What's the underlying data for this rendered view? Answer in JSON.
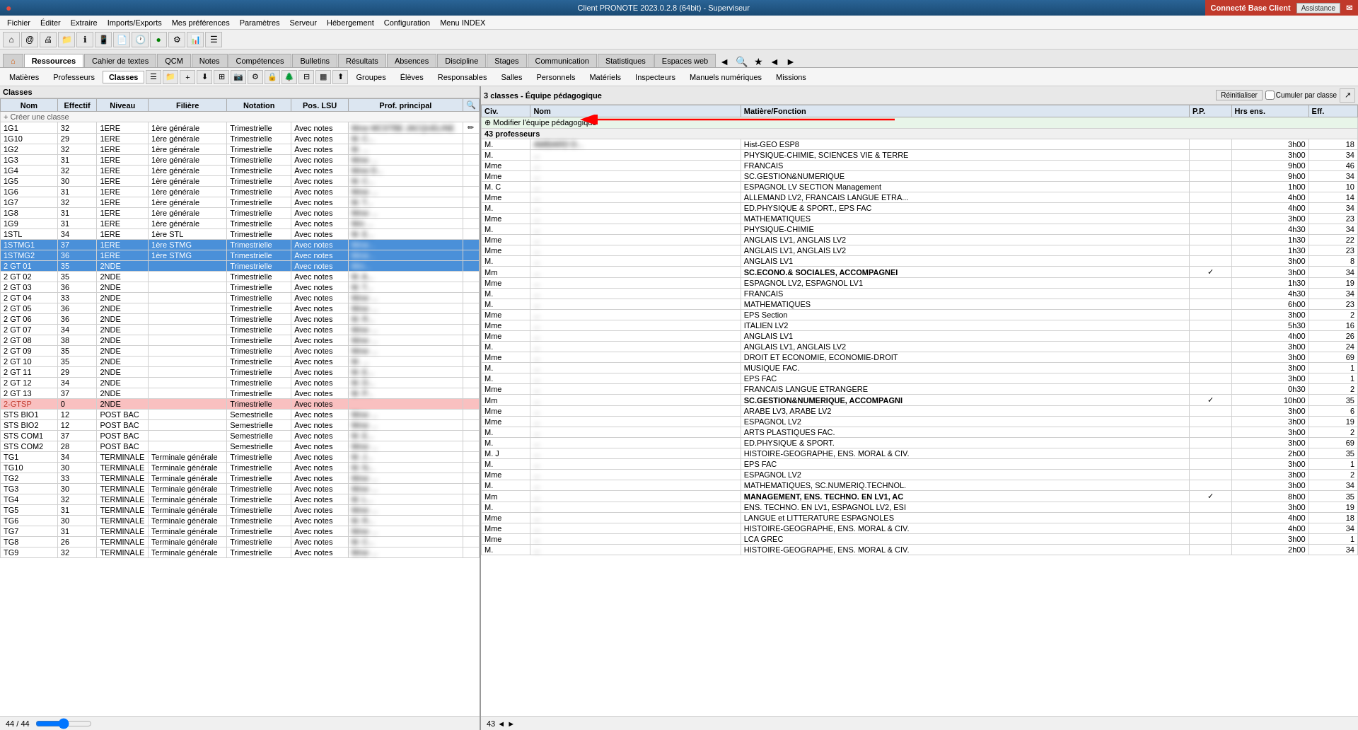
{
  "titleBar": {
    "title": "Client PRONOTE 2023.0.2.8 (64bit) - Superviseur",
    "connected": "Connecté Base Client",
    "assistance": "Assistance"
  },
  "menuBar": {
    "items": [
      "Fichier",
      "Éditer",
      "Extraire",
      "Imports/Exports",
      "Mes préférences",
      "Paramètres",
      "Serveur",
      "Hébergement",
      "Configuration",
      "Menu INDEX"
    ]
  },
  "navTabs": {
    "tabs": [
      "Ressources",
      "Cahier de textes",
      "QCM",
      "Notes",
      "Compétences",
      "Bulletins",
      "Résultats",
      "Absences",
      "Discipline",
      "Stages",
      "Communication",
      "Statistiques",
      "Espaces web"
    ]
  },
  "subNav": {
    "items": [
      "Matières",
      "Professeurs",
      "Classes",
      "Groupes",
      "Élèves",
      "Responsables",
      "Salles",
      "Personnels",
      "Matériels",
      "Inspecteurs",
      "Manuels numériques",
      "Missions"
    ]
  },
  "leftPanel": {
    "header": "Classes",
    "columns": [
      "Nom",
      "Effectif",
      "Niveau",
      "Filière",
      "Notation",
      "Pos. LSU",
      "Prof. principal"
    ],
    "createRow": "+ Créer une classe",
    "rows": [
      {
        "nom": "1G1",
        "effectif": "32",
        "niveau": "1ERE",
        "filiere": "1ère générale",
        "notation": "Trimestrielle",
        "posLSU": "Avec notes",
        "prof": "Mme MCSTBE JACQUELINE"
      },
      {
        "nom": "1G10",
        "effectif": "29",
        "niveau": "1ERE",
        "filiere": "1ère générale",
        "notation": "Trimestrielle",
        "posLSU": "Avec notes",
        "prof": "M. C..."
      },
      {
        "nom": "1G2",
        "effectif": "32",
        "niveau": "1ERE",
        "filiere": "1ère générale",
        "notation": "Trimestrielle",
        "posLSU": "Avec notes",
        "prof": "M. ..."
      },
      {
        "nom": "1G3",
        "effectif": "31",
        "niveau": "1ERE",
        "filiere": "1ère générale",
        "notation": "Trimestrielle",
        "posLSU": "Avec notes",
        "prof": "Mme ..."
      },
      {
        "nom": "1G4",
        "effectif": "32",
        "niveau": "1ERE",
        "filiere": "1ère générale",
        "notation": "Trimestrielle",
        "posLSU": "Avec notes",
        "prof": "Mme D..."
      },
      {
        "nom": "1G5",
        "effectif": "30",
        "niveau": "1ERE",
        "filiere": "1ère générale",
        "notation": "Trimestrielle",
        "posLSU": "Avec notes",
        "prof": "M. C..."
      },
      {
        "nom": "1G6",
        "effectif": "31",
        "niveau": "1ERE",
        "filiere": "1ère générale",
        "notation": "Trimestrielle",
        "posLSU": "Avec notes",
        "prof": "Mme ..."
      },
      {
        "nom": "1G7",
        "effectif": "32",
        "niveau": "1ERE",
        "filiere": "1ère générale",
        "notation": "Trimestrielle",
        "posLSU": "Avec notes",
        "prof": "M. T..."
      },
      {
        "nom": "1G8",
        "effectif": "31",
        "niveau": "1ERE",
        "filiere": "1ère générale",
        "notation": "Trimestrielle",
        "posLSU": "Avec notes",
        "prof": "Mme ..."
      },
      {
        "nom": "1G9",
        "effectif": "31",
        "niveau": "1ERE",
        "filiere": "1ère générale",
        "notation": "Trimestrielle",
        "posLSU": "Avec notes",
        "prof": "Mm ..."
      },
      {
        "nom": "1STL",
        "effectif": "34",
        "niveau": "1ERE",
        "filiere": "1ère STL",
        "notation": "Trimestrielle",
        "posLSU": "Avec notes",
        "prof": "M. E..."
      },
      {
        "nom": "1STMG1",
        "effectif": "37",
        "niveau": "1ERE",
        "filiere": "1ère STMG",
        "notation": "Trimestrielle",
        "posLSU": "Avec notes",
        "prof": "Mme...",
        "selected": true
      },
      {
        "nom": "1STMG2",
        "effectif": "36",
        "niveau": "1ERE",
        "filiere": "1ère STMG",
        "notation": "Trimestrielle",
        "posLSU": "Avec notes",
        "prof": "Mme...",
        "selected": true
      },
      {
        "nom": "2 GT 01",
        "effectif": "35",
        "niveau": "2NDE",
        "filiere": "",
        "notation": "Trimestrielle",
        "posLSU": "Avec notes",
        "prof": "Mm...",
        "selected": true
      },
      {
        "nom": "2 GT 02",
        "effectif": "35",
        "niveau": "2NDE",
        "filiere": "",
        "notation": "Trimestrielle",
        "posLSU": "Avec notes",
        "prof": "M. A..."
      },
      {
        "nom": "2 GT 03",
        "effectif": "36",
        "niveau": "2NDE",
        "filiere": "",
        "notation": "Trimestrielle",
        "posLSU": "Avec notes",
        "prof": "M. T..."
      },
      {
        "nom": "2 GT 04",
        "effectif": "33",
        "niveau": "2NDE",
        "filiere": "",
        "notation": "Trimestrielle",
        "posLSU": "Avec notes",
        "prof": "Mme ..."
      },
      {
        "nom": "2 GT 05",
        "effectif": "36",
        "niveau": "2NDE",
        "filiere": "",
        "notation": "Trimestrielle",
        "posLSU": "Avec notes",
        "prof": "Mme ..."
      },
      {
        "nom": "2 GT 06",
        "effectif": "36",
        "niveau": "2NDE",
        "filiere": "",
        "notation": "Trimestrielle",
        "posLSU": "Avec notes",
        "prof": "M. R..."
      },
      {
        "nom": "2 GT 07",
        "effectif": "34",
        "niveau": "2NDE",
        "filiere": "",
        "notation": "Trimestrielle",
        "posLSU": "Avec notes",
        "prof": "Mme ..."
      },
      {
        "nom": "2 GT 08",
        "effectif": "38",
        "niveau": "2NDE",
        "filiere": "",
        "notation": "Trimestrielle",
        "posLSU": "Avec notes",
        "prof": "Mme ..."
      },
      {
        "nom": "2 GT 09",
        "effectif": "35",
        "niveau": "2NDE",
        "filiere": "",
        "notation": "Trimestrielle",
        "posLSU": "Avec notes",
        "prof": "Mme ..."
      },
      {
        "nom": "2 GT 10",
        "effectif": "35",
        "niveau": "2NDE",
        "filiere": "",
        "notation": "Trimestrielle",
        "posLSU": "Avec notes",
        "prof": "M. ..."
      },
      {
        "nom": "2 GT 11",
        "effectif": "29",
        "niveau": "2NDE",
        "filiere": "",
        "notation": "Trimestrielle",
        "posLSU": "Avec notes",
        "prof": "M. E..."
      },
      {
        "nom": "2 GT 12",
        "effectif": "34",
        "niveau": "2NDE",
        "filiere": "",
        "notation": "Trimestrielle",
        "posLSU": "Avec notes",
        "prof": "M. D..."
      },
      {
        "nom": "2 GT 13",
        "effectif": "37",
        "niveau": "2NDE",
        "filiere": "",
        "notation": "Trimestrielle",
        "posLSU": "Avec notes",
        "prof": "M. P..."
      },
      {
        "nom": "2-GTSP",
        "effectif": "0",
        "niveau": "2NDE",
        "filiere": "",
        "notation": "Trimestrielle",
        "posLSU": "Avec notes",
        "prof": "",
        "highlighted": true
      },
      {
        "nom": "STS BIO1",
        "effectif": "12",
        "niveau": "POST BAC",
        "filiere": "",
        "notation": "Semestrielle",
        "posLSU": "Avec notes",
        "prof": "Mme ..."
      },
      {
        "nom": "STS BIO2",
        "effectif": "12",
        "niveau": "POST BAC",
        "filiere": "",
        "notation": "Semestrielle",
        "posLSU": "Avec notes",
        "prof": "Mme ..."
      },
      {
        "nom": "STS COM1",
        "effectif": "37",
        "niveau": "POST BAC",
        "filiere": "",
        "notation": "Semestrielle",
        "posLSU": "Avec notes",
        "prof": "M. E..."
      },
      {
        "nom": "STS COM2",
        "effectif": "28",
        "niveau": "POST BAC",
        "filiere": "",
        "notation": "Semestrielle",
        "posLSU": "Avec notes",
        "prof": "Mme ..."
      },
      {
        "nom": "TG1",
        "effectif": "34",
        "niveau": "TERMINALE",
        "filiere": "Terminale générale",
        "notation": "Trimestrielle",
        "posLSU": "Avec notes",
        "prof": "M. J..."
      },
      {
        "nom": "TG10",
        "effectif": "30",
        "niveau": "TERMINALE",
        "filiere": "Terminale générale",
        "notation": "Trimestrielle",
        "posLSU": "Avec notes",
        "prof": "M. N..."
      },
      {
        "nom": "TG2",
        "effectif": "33",
        "niveau": "TERMINALE",
        "filiere": "Terminale générale",
        "notation": "Trimestrielle",
        "posLSU": "Avec notes",
        "prof": "Mme ..."
      },
      {
        "nom": "TG3",
        "effectif": "30",
        "niveau": "TERMINALE",
        "filiere": "Terminale générale",
        "notation": "Trimestrielle",
        "posLSU": "Avec notes",
        "prof": "Mme ..."
      },
      {
        "nom": "TG4",
        "effectif": "32",
        "niveau": "TERMINALE",
        "filiere": "Terminale générale",
        "notation": "Trimestrielle",
        "posLSU": "Avec notes",
        "prof": "M. L..."
      },
      {
        "nom": "TG5",
        "effectif": "31",
        "niveau": "TERMINALE",
        "filiere": "Terminale générale",
        "notation": "Trimestrielle",
        "posLSU": "Avec notes",
        "prof": "Mme ..."
      },
      {
        "nom": "TG6",
        "effectif": "30",
        "niveau": "TERMINALE",
        "filiere": "Terminale générale",
        "notation": "Trimestrielle",
        "posLSU": "Avec notes",
        "prof": "M. R..."
      },
      {
        "nom": "TG7",
        "effectif": "31",
        "niveau": "TERMINALE",
        "filiere": "Terminale générale",
        "notation": "Trimestrielle",
        "posLSU": "Avec notes",
        "prof": "Mme ..."
      },
      {
        "nom": "TG8",
        "effectif": "26",
        "niveau": "TERMINALE",
        "filiere": "Terminale générale",
        "notation": "Trimestrielle",
        "posLSU": "Avec notes",
        "prof": "M. C..."
      },
      {
        "nom": "TG9",
        "effectif": "32",
        "niveau": "TERMINALE",
        "filiere": "Terminale générale",
        "notation": "Trimestrielle",
        "posLSU": "Avec notes",
        "prof": "Mme ..."
      }
    ]
  },
  "rightPanel": {
    "header": "3 classes - Équipe pédagogique",
    "resetBtn": "Réinitialiser",
    "cumulerLabel": "Cumuler par classe",
    "columns": [
      "Civ.",
      "Nom",
      "Matière/Fonction",
      "P.P.",
      "Hrs ens.",
      "Eff."
    ],
    "modifyRow": "Modifier l'équipe pédagogique",
    "teacherCount": "43 professeurs",
    "teachers": [
      {
        "civ": "M.",
        "nom": "AMBIARD D...",
        "matiere": "Hist-GEO ESP8",
        "pp": "",
        "hrs": "3h00",
        "eff": "18"
      },
      {
        "civ": "M.",
        "nom": "...",
        "matiere": "PHYSIQUE-CHIMIE, SCIENCES VIE & TERRE",
        "pp": "",
        "hrs": "3h00",
        "eff": "34"
      },
      {
        "civ": "Mme",
        "nom": "...",
        "matiere": "FRANCAIS",
        "pp": "",
        "hrs": "9h00",
        "eff": "46"
      },
      {
        "civ": "Mme",
        "nom": "...",
        "matiere": "SC.GESTION&NUMERIQUE",
        "pp": "",
        "hrs": "9h00",
        "eff": "34"
      },
      {
        "civ": "M. C",
        "nom": "...",
        "matiere": "ESPAGNOL LV SECTION Management",
        "pp": "",
        "hrs": "1h00",
        "eff": "10"
      },
      {
        "civ": "Mme",
        "nom": "...",
        "matiere": "ALLEMAND LV2, FRANCAIS LANGUE ETRA...",
        "pp": "",
        "hrs": "4h00",
        "eff": "14"
      },
      {
        "civ": "M.",
        "nom": "...",
        "matiere": "ED.PHYSIQUE & SPORT., EPS FAC",
        "pp": "",
        "hrs": "4h00",
        "eff": "34"
      },
      {
        "civ": "Mme",
        "nom": "...",
        "matiere": "MATHEMATIQUES",
        "pp": "",
        "hrs": "3h00",
        "eff": "23"
      },
      {
        "civ": "M.",
        "nom": "...",
        "matiere": "PHYSIQUE-CHIMIE",
        "pp": "",
        "hrs": "4h30",
        "eff": "34"
      },
      {
        "civ": "Mme",
        "nom": "...",
        "matiere": "ANGLAIS LV1, ANGLAIS LV2",
        "pp": "",
        "hrs": "1h30",
        "eff": "22"
      },
      {
        "civ": "Mme",
        "nom": "...",
        "matiere": "ANGLAIS LV1, ANGLAIS LV2",
        "pp": "",
        "hrs": "1h30",
        "eff": "23"
      },
      {
        "civ": "M.",
        "nom": "...",
        "matiere": "ANGLAIS LV1",
        "pp": "",
        "hrs": "3h00",
        "eff": "8"
      },
      {
        "civ": "Mm",
        "nom": "...",
        "matiere": "SC.ECONO.& SOCIALES, ACCOMPAGNEI",
        "pp": "✓",
        "hrs": "3h00",
        "eff": "34",
        "bold": true
      },
      {
        "civ": "Mme",
        "nom": "...",
        "matiere": "ESPAGNOL LV2, ESPAGNOL LV1",
        "pp": "",
        "hrs": "1h30",
        "eff": "19"
      },
      {
        "civ": "M.",
        "nom": "...",
        "matiere": "FRANCAIS",
        "pp": "",
        "hrs": "4h30",
        "eff": "34"
      },
      {
        "civ": "M.",
        "nom": "...",
        "matiere": "MATHEMATIQUES",
        "pp": "",
        "hrs": "6h00",
        "eff": "23"
      },
      {
        "civ": "Mme",
        "nom": "...",
        "matiere": "EPS Section",
        "pp": "",
        "hrs": "3h00",
        "eff": "2"
      },
      {
        "civ": "Mme",
        "nom": "...",
        "matiere": "ITALIEN LV2",
        "pp": "",
        "hrs": "5h30",
        "eff": "16"
      },
      {
        "civ": "Mme",
        "nom": "...",
        "matiere": "ANGLAIS LV1",
        "pp": "",
        "hrs": "4h00",
        "eff": "26"
      },
      {
        "civ": "M.",
        "nom": "...",
        "matiere": "ANGLAIS LV1, ANGLAIS LV2",
        "pp": "",
        "hrs": "3h00",
        "eff": "24"
      },
      {
        "civ": "Mme",
        "nom": "...",
        "matiere": "DROIT ET ECONOMIE, ECONOMIE-DROIT",
        "pp": "",
        "hrs": "3h00",
        "eff": "69"
      },
      {
        "civ": "M.",
        "nom": "...",
        "matiere": "MUSIQUE FAC.",
        "pp": "",
        "hrs": "3h00",
        "eff": "1"
      },
      {
        "civ": "M.",
        "nom": "...",
        "matiere": "EPS FAC",
        "pp": "",
        "hrs": "3h00",
        "eff": "1"
      },
      {
        "civ": "Mme",
        "nom": "...",
        "matiere": "FRANCAIS LANGUE ETRANGERE",
        "pp": "",
        "hrs": "0h30",
        "eff": "2"
      },
      {
        "civ": "Mm",
        "nom": "...",
        "matiere": "SC.GESTION&NUMERIQUE, ACCOMPAGNI",
        "pp": "✓",
        "hrs": "10h00",
        "eff": "35",
        "bold": true
      },
      {
        "civ": "Mme",
        "nom": "...",
        "matiere": "ARABE LV3, ARABE LV2",
        "pp": "",
        "hrs": "3h00",
        "eff": "6"
      },
      {
        "civ": "Mme",
        "nom": "...",
        "matiere": "ESPAGNOL LV2",
        "pp": "",
        "hrs": "3h00",
        "eff": "19"
      },
      {
        "civ": "M.",
        "nom": "...",
        "matiere": "ARTS PLASTIQUES FAC.",
        "pp": "",
        "hrs": "3h00",
        "eff": "2"
      },
      {
        "civ": "M.",
        "nom": "...",
        "matiere": "ED.PHYSIQUE & SPORT.",
        "pp": "",
        "hrs": "3h00",
        "eff": "69"
      },
      {
        "civ": "M. J",
        "nom": "...",
        "matiere": "HISTOIRE-GEOGRAPHE, ENS. MORAL & CIV.",
        "pp": "",
        "hrs": "2h00",
        "eff": "35"
      },
      {
        "civ": "M.",
        "nom": "...",
        "matiere": "EPS FAC",
        "pp": "",
        "hrs": "3h00",
        "eff": "1"
      },
      {
        "civ": "Mme",
        "nom": "...",
        "matiere": "ESPAGNOL LV2",
        "pp": "",
        "hrs": "3h00",
        "eff": "2"
      },
      {
        "civ": "M.",
        "nom": "...",
        "matiere": "MATHEMATIQUES, SC.NUMERIQ.TECHNOL.",
        "pp": "",
        "hrs": "3h00",
        "eff": "34"
      },
      {
        "civ": "Mm",
        "nom": "...",
        "matiere": "MANAGEMENT, ENS. TECHNO. EN LV1, AC",
        "pp": "✓",
        "hrs": "8h00",
        "eff": "35",
        "bold": true
      },
      {
        "civ": "M.",
        "nom": "...",
        "matiere": "ENS. TECHNO. EN LV1, ESPAGNOL LV2, ESI",
        "pp": "",
        "hrs": "3h00",
        "eff": "19"
      },
      {
        "civ": "Mme",
        "nom": "...",
        "matiere": "LANGUE et LITTERATURE ESPAGNOLES",
        "pp": "",
        "hrs": "4h00",
        "eff": "18"
      },
      {
        "civ": "Mme",
        "nom": "...",
        "matiere": "HISTOIRE-GEOGRAPHE, ENS. MORAL & CIV.",
        "pp": "",
        "hrs": "4h00",
        "eff": "34"
      },
      {
        "civ": "Mme",
        "nom": "...",
        "matiere": "LCA GREC",
        "pp": "",
        "hrs": "3h00",
        "eff": "1"
      },
      {
        "civ": "M.",
        "nom": "...",
        "matiere": "HISTOIRE-GEOGRAPHE, ENS. MORAL & CIV.",
        "pp": "",
        "hrs": "2h00",
        "eff": "34"
      }
    ]
  },
  "bottomBar": {
    "pageInfo": "44 / 44",
    "rightCount": "43 ◄ ►"
  },
  "icons": {
    "home": "⌂",
    "search": "🔍",
    "star": "★",
    "prev": "◄",
    "next": "►",
    "pencil": "✏",
    "add": "+"
  }
}
